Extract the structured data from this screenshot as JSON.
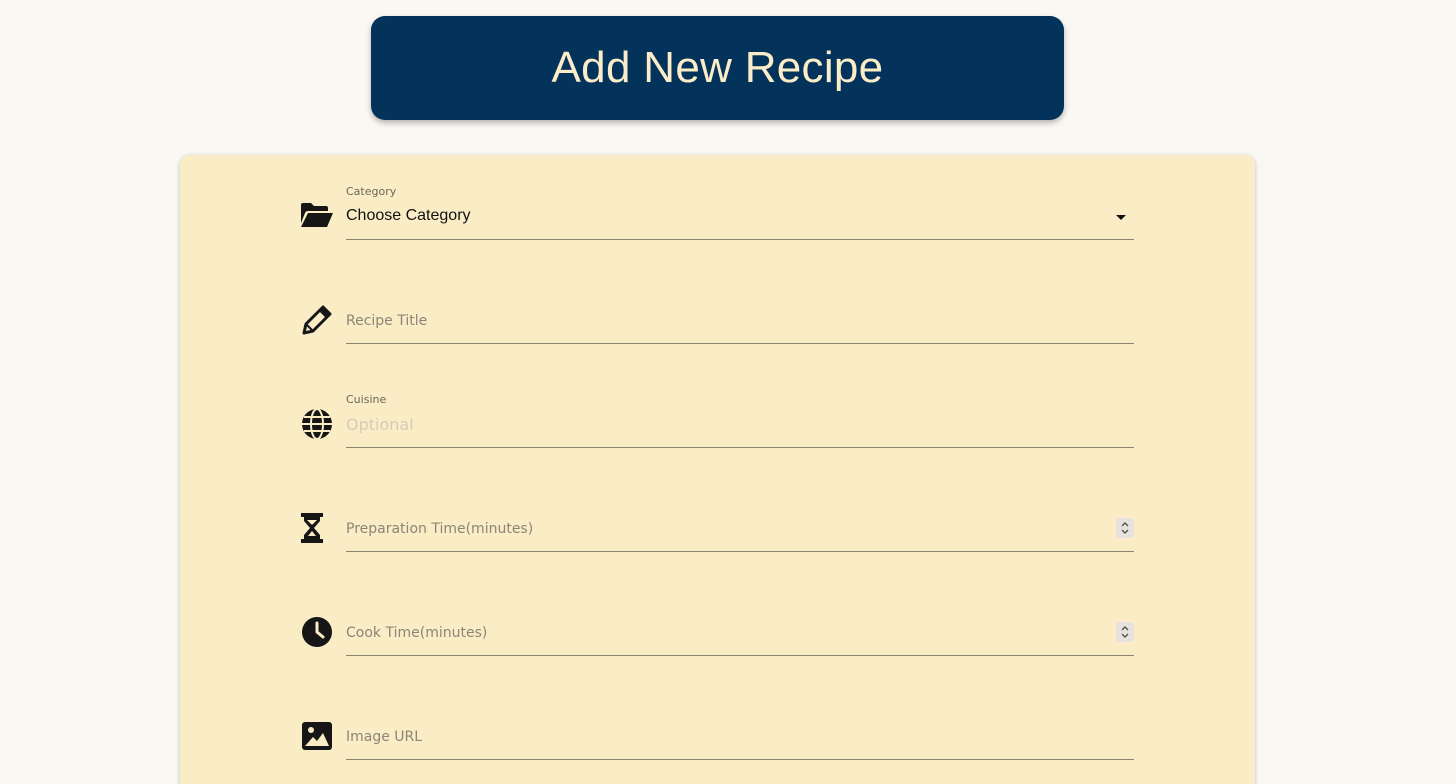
{
  "header": {
    "title": "Add New Recipe"
  },
  "form": {
    "category": {
      "label": "Category",
      "selected": "Choose Category",
      "icon": "folder-open-icon"
    },
    "recipe_title": {
      "placeholder": "Recipe Title",
      "icon": "pencil-icon"
    },
    "cuisine": {
      "label": "Cuisine",
      "placeholder": "Optional",
      "icon": "globe-icon"
    },
    "prep_time": {
      "placeholder": "Preparation Time(minutes)",
      "icon": "hourglass-icon"
    },
    "cook_time": {
      "placeholder": "Cook Time(minutes)",
      "icon": "clock-icon"
    },
    "image_url": {
      "placeholder": "Image URL",
      "icon": "image-icon"
    }
  },
  "colors": {
    "background": "#faf8f3",
    "banner": "#03325a",
    "banner_text": "#fbedc8",
    "card": "#faedc6"
  }
}
